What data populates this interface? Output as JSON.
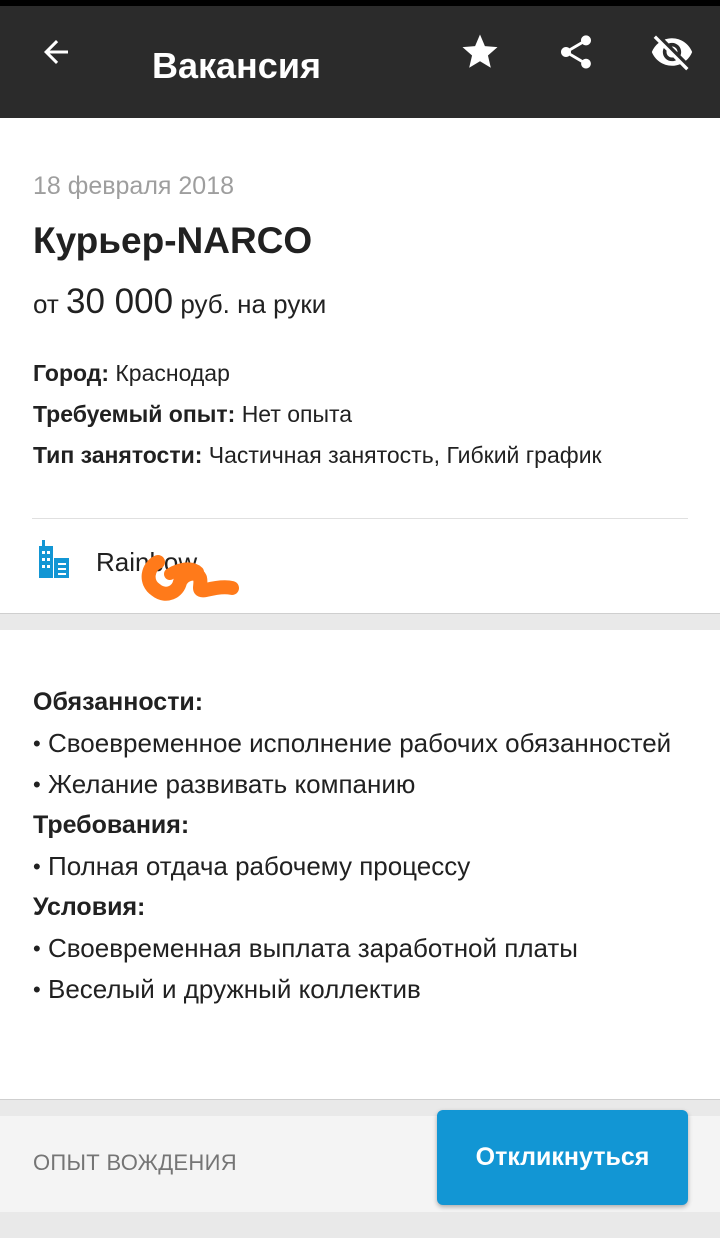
{
  "appbar": {
    "back_icon": "arrow-back-icon",
    "title": "Вакансия",
    "star_icon": "star-icon",
    "share_icon": "share-icon",
    "hide_icon": "visibility-off-icon"
  },
  "vacancy": {
    "date": "18 февраля 2018",
    "title": "Курьер-NARCO",
    "salary_prefix": "от",
    "salary_amount": "30 000",
    "salary_suffix": "руб. на руки",
    "fields": [
      {
        "label": "Город:",
        "value": "Краснодар"
      },
      {
        "label": "Требуемый опыт:",
        "value": "Нет опыта"
      },
      {
        "label": "Тип занятости:",
        "value": "Частичная занятость, Гибкий график"
      }
    ],
    "company_icon": "building-icon",
    "company_name": "Rainbow"
  },
  "description": {
    "duties_heading": "Обязанности:",
    "duties": [
      "Своевременное исполнение рабочих обязанностей",
      "Желание развивать компанию"
    ],
    "requirements_heading": "Требования:",
    "requirements": [
      "Полная отдача рабочему процессу"
    ],
    "conditions_heading": "Условия:",
    "conditions": [
      "Своевременная выплата заработной платы",
      "Веселый и дружный коллектив"
    ]
  },
  "footer": {
    "driving_label": "ОПЫТ ВОЖДЕНИЯ",
    "apply_label": "Откликнуться"
  },
  "colors": {
    "appbar": "#2b2b2b",
    "accent": "#1296d4",
    "scribble": "#ff7a1a"
  }
}
